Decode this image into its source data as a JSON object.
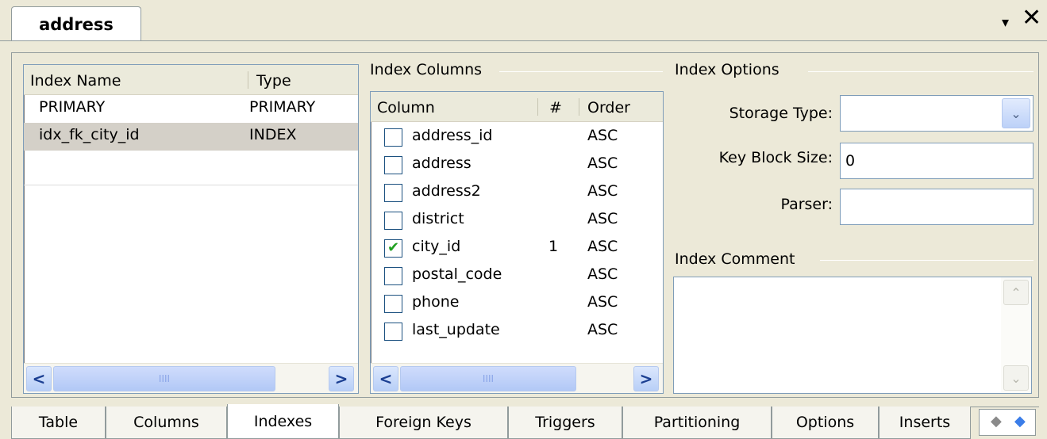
{
  "doc_tab": {
    "title": "address"
  },
  "window_controls": {
    "menu_glyph": "▾",
    "close_glyph": "✕"
  },
  "indexes_list": {
    "headers": {
      "name": "Index Name",
      "type": "Type"
    },
    "rows": [
      {
        "name": "PRIMARY",
        "type": "PRIMARY",
        "selected": false
      },
      {
        "name": "idx_fk_city_id",
        "type": "INDEX",
        "selected": true
      }
    ]
  },
  "index_columns": {
    "group_label": "Index Columns",
    "headers": {
      "column": "Column",
      "num": "#",
      "order": "Order"
    },
    "rows": [
      {
        "column": "address_id",
        "num": "",
        "order": "ASC",
        "checked": false
      },
      {
        "column": "address",
        "num": "",
        "order": "ASC",
        "checked": false
      },
      {
        "column": "address2",
        "num": "",
        "order": "ASC",
        "checked": false
      },
      {
        "column": "district",
        "num": "",
        "order": "ASC",
        "checked": false
      },
      {
        "column": "city_id",
        "num": "1",
        "order": "ASC",
        "checked": true
      },
      {
        "column": "postal_code",
        "num": "",
        "order": "ASC",
        "checked": false
      },
      {
        "column": "phone",
        "num": "",
        "order": "ASC",
        "checked": false
      },
      {
        "column": "last_update",
        "num": "",
        "order": "ASC",
        "checked": false
      }
    ]
  },
  "index_options": {
    "group_label": "Index Options",
    "storage_type_label": "Storage Type:",
    "storage_type_value": "",
    "key_block_size_label": "Key Block Size:",
    "key_block_size_value": "0",
    "parser_label": "Parser:",
    "parser_value": ""
  },
  "index_comment": {
    "group_label": "Index Comment",
    "value": ""
  },
  "bottom_tabs": [
    {
      "label": "Table",
      "active": false
    },
    {
      "label": "Columns",
      "active": false
    },
    {
      "label": "Indexes",
      "active": true
    },
    {
      "label": "Foreign Keys",
      "active": false
    },
    {
      "label": "Triggers",
      "active": false
    },
    {
      "label": "Partitioning",
      "active": false
    },
    {
      "label": "Options",
      "active": false
    },
    {
      "label": "Inserts",
      "active": false
    }
  ],
  "icons": {
    "scroll_left": "<",
    "scroll_right": ">",
    "thumb_grip": "IIII",
    "scroll_up": "⌃",
    "scroll_down": "⌄",
    "dropdown": "⌄",
    "check": "✔",
    "tab_prev": "◆",
    "tab_next": "◆"
  },
  "colors": {
    "selection": "#d4d0c8",
    "check": "#21a121",
    "tab_next": "#3b7de8"
  }
}
